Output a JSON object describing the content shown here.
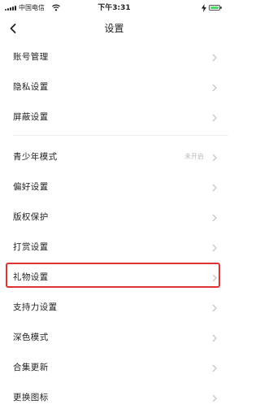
{
  "status_bar": {
    "carrier": "中国电信",
    "time": "下午3:31"
  },
  "header": {
    "title": "设置"
  },
  "settings": {
    "items": [
      {
        "label": "账号管理",
        "value": ""
      },
      {
        "label": "隐私设置",
        "value": ""
      },
      {
        "label": "屏蔽设置",
        "value": ""
      },
      {
        "label": "青少年模式",
        "value": "未开启"
      },
      {
        "label": "偏好设置",
        "value": ""
      },
      {
        "label": "版权保护",
        "value": ""
      },
      {
        "label": "打赏设置",
        "value": ""
      },
      {
        "label": "礼物设置",
        "value": ""
      },
      {
        "label": "支持力设置",
        "value": ""
      },
      {
        "label": "深色模式",
        "value": ""
      },
      {
        "label": "合集更新",
        "value": ""
      },
      {
        "label": "更换图标",
        "value": ""
      }
    ],
    "highlighted_item": "礼物设置"
  },
  "colors": {
    "highlight_border": "#e03232",
    "battery_fill": "#4cd964",
    "secondary_text": "#bbbbbb"
  },
  "icons": [
    "signal-icon",
    "wifi-icon",
    "battery-icon",
    "charging-icon",
    "back-chevron-icon",
    "chevron-right-icon"
  ]
}
